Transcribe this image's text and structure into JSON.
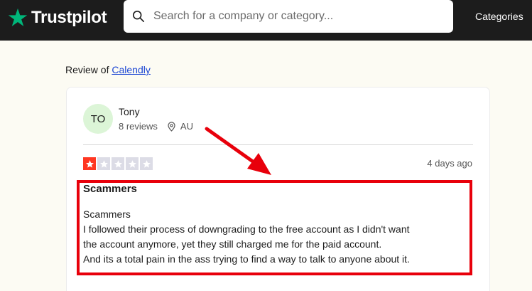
{
  "header": {
    "brand": "Trustpilot",
    "search_placeholder": "Search for a company or category...",
    "categories_label": "Categories"
  },
  "breadcrumb": {
    "prefix": "Review of",
    "company": "Calendly"
  },
  "review": {
    "avatar_initials": "TO",
    "reviewer_name": "Tony",
    "review_count": "8 reviews",
    "country": "AU",
    "rating": 1,
    "rating_max": 5,
    "date": "4 days ago",
    "title": "Scammers",
    "body_lines": [
      "Scammers",
      "I followed their process of downgrading to the free account as I didn't want",
      "the account anymore, yet they still charged me for the paid account.",
      "And its a total pain in the ass trying to find a way to talk to anyone about it."
    ]
  },
  "colors": {
    "brand_green": "#00b67a",
    "rating_red": "#ff3722",
    "annotation_red": "#e8000b",
    "link_blue": "#1d47d4"
  }
}
